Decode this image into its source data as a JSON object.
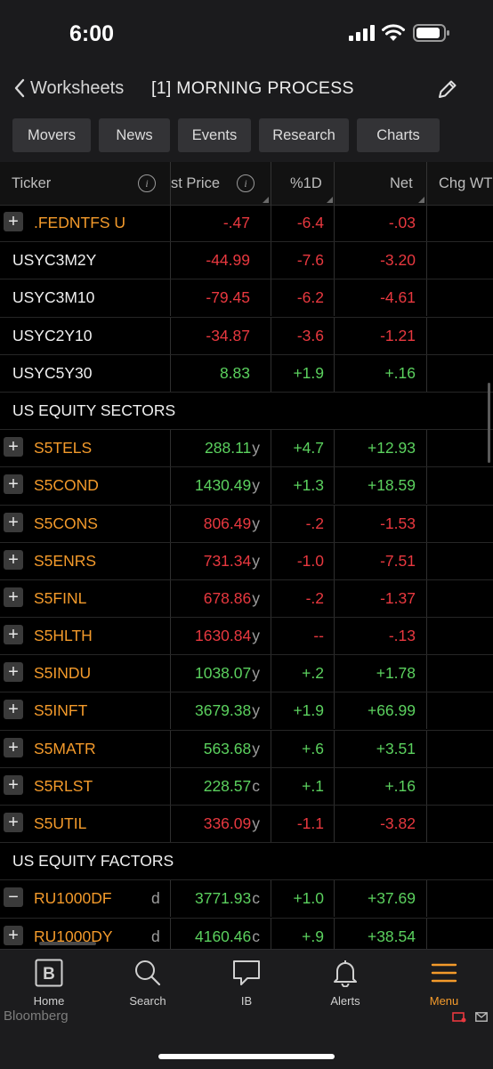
{
  "status": {
    "time": "6:00"
  },
  "nav": {
    "back_label": "Worksheets",
    "title": "[1] MORNING PROCESS",
    "tabs": [
      "Movers",
      "News",
      "Events",
      "Research",
      "Charts"
    ]
  },
  "columns": {
    "ticker": "Ticker",
    "price": "st Price",
    "pct": "%1D",
    "net": "Net",
    "chg": "Chg WT"
  },
  "rows": [
    {
      "ticker": ".FEDNTFS U",
      "expand": "+",
      "price": "-.47",
      "suffix": "",
      "pct": "-6.4",
      "net": "-.03",
      "color": "red"
    },
    {
      "ticker": "USYC3M2Y",
      "expand": "",
      "price": "-44.99",
      "suffix": "",
      "pct": "-7.6",
      "net": "-3.20",
      "color": "red"
    },
    {
      "ticker": "USYC3M10",
      "expand": "",
      "price": "-79.45",
      "suffix": "",
      "pct": "-6.2",
      "net": "-4.61",
      "color": "red"
    },
    {
      "ticker": "USYC2Y10",
      "expand": "",
      "price": "-34.87",
      "suffix": "",
      "pct": "-3.6",
      "net": "-1.21",
      "color": "red"
    },
    {
      "ticker": "USYC5Y30",
      "expand": "",
      "price": "8.83",
      "suffix": "",
      "pct": "+1.9",
      "net": "+.16",
      "color": "green"
    },
    {
      "section": "US EQUITY SECTORS"
    },
    {
      "ticker": "S5TELS",
      "expand": "+",
      "price": "288.11",
      "suffix": "y",
      "pct": "+4.7",
      "net": "+12.93",
      "color": "green"
    },
    {
      "ticker": "S5COND",
      "expand": "+",
      "price": "1430.49",
      "suffix": "y",
      "pct": "+1.3",
      "net": "+18.59",
      "color": "green"
    },
    {
      "ticker": "S5CONS",
      "expand": "+",
      "price": "806.49",
      "suffix": "y",
      "pct": "-.2",
      "net": "-1.53",
      "color": "red"
    },
    {
      "ticker": "S5ENRS",
      "expand": "+",
      "price": "731.34",
      "suffix": "y",
      "pct": "-1.0",
      "net": "-7.51",
      "color": "red"
    },
    {
      "ticker": "S5FINL",
      "expand": "+",
      "price": "678.86",
      "suffix": "y",
      "pct": "-.2",
      "net": "-1.37",
      "color": "red"
    },
    {
      "ticker": "S5HLTH",
      "expand": "+",
      "price": "1630.84",
      "suffix": "y",
      "pct": "--",
      "net": "-.13",
      "color": "red"
    },
    {
      "ticker": "S5INDU",
      "expand": "+",
      "price": "1038.07",
      "suffix": "y",
      "pct": "+.2",
      "net": "+1.78",
      "color": "green"
    },
    {
      "ticker": "S5INFT",
      "expand": "+",
      "price": "3679.38",
      "suffix": "y",
      "pct": "+1.9",
      "net": "+66.99",
      "color": "green"
    },
    {
      "ticker": "S5MATR",
      "expand": "+",
      "price": "563.68",
      "suffix": "y",
      "pct": "+.6",
      "net": "+3.51",
      "color": "green"
    },
    {
      "ticker": "S5RLST",
      "expand": "+",
      "price": "228.57",
      "suffix": "c",
      "pct": "+.1",
      "net": "+.16",
      "color": "green"
    },
    {
      "ticker": "S5UTIL",
      "expand": "+",
      "price": "336.09",
      "suffix": "y",
      "pct": "-1.1",
      "net": "-3.82",
      "color": "red"
    },
    {
      "section": "US EQUITY FACTORS"
    },
    {
      "ticker": "RU1000DF",
      "expand": "−",
      "flag": "d",
      "price": "3771.93",
      "suffix": "c",
      "pct": "+1.0",
      "net": "+37.69",
      "color": "green"
    },
    {
      "ticker": "RU1000DY",
      "expand": "+",
      "flag": "d",
      "price": "4160.46",
      "suffix": "c",
      "pct": "+.9",
      "net": "+38.54",
      "color": "green"
    }
  ],
  "tabbar": {
    "items": [
      {
        "label": "Home",
        "icon": "bloomberg-b-icon"
      },
      {
        "label": "Search",
        "icon": "search-icon"
      },
      {
        "label": "IB",
        "icon": "chat-icon"
      },
      {
        "label": "Alerts",
        "icon": "bell-icon"
      },
      {
        "label": "Menu",
        "icon": "menu-icon"
      }
    ],
    "brand": "Bloomberg",
    "active_color": "#f39a2b"
  },
  "colors": {
    "accent": "#f39a2b",
    "up": "#5bd15e",
    "down": "#e8383f"
  }
}
